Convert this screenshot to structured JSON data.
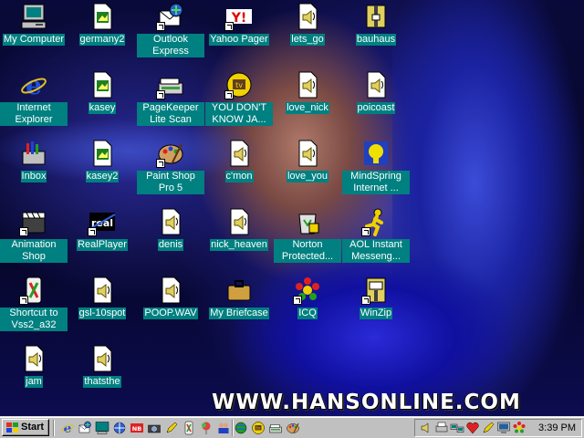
{
  "desktop": {
    "watermark": "WWW.HANSONLINE.COM",
    "icons": [
      {
        "id": "my-computer",
        "label": "My Computer",
        "icon": "computer-icon",
        "shortcut": false
      },
      {
        "id": "germany2",
        "label": "germany2",
        "icon": "image-file-icon",
        "shortcut": false
      },
      {
        "id": "outlook-express",
        "label": "Outlook Express",
        "icon": "outlook-express-icon",
        "shortcut": true
      },
      {
        "id": "yahoo-pager",
        "label": "Yahoo Pager",
        "icon": "yahoo-pager-icon",
        "shortcut": true
      },
      {
        "id": "lets-go",
        "label": "lets_go",
        "icon": "sound-file-icon",
        "shortcut": false
      },
      {
        "id": "bauhaus",
        "label": "bauhaus",
        "icon": "zip-archive-icon",
        "shortcut": false
      },
      {
        "id": "internet-explorer",
        "label": "Internet Explorer",
        "icon": "internet-explorer-icon",
        "shortcut": false
      },
      {
        "id": "kasey",
        "label": "kasey",
        "icon": "image-file-icon",
        "shortcut": false
      },
      {
        "id": "pagekeeper",
        "label": "PageKeeper Lite Scan",
        "icon": "scanner-icon",
        "shortcut": true
      },
      {
        "id": "you-dont-know-jack",
        "label": "YOU DON'T KNOW JA...",
        "icon": "tv-game-icon",
        "shortcut": true
      },
      {
        "id": "love-nick",
        "label": "love_nick",
        "icon": "sound-file-icon",
        "shortcut": false
      },
      {
        "id": "poicoast",
        "label": "poicoast",
        "icon": "sound-file-icon",
        "shortcut": false
      },
      {
        "id": "inbox",
        "label": "Inbox",
        "icon": "inbox-icon",
        "shortcut": false
      },
      {
        "id": "kasey2",
        "label": "kasey2",
        "icon": "image-file-icon",
        "shortcut": false
      },
      {
        "id": "paint-shop-pro",
        "label": "Paint Shop Pro 5",
        "icon": "paint-palette-icon",
        "shortcut": true
      },
      {
        "id": "cmon",
        "label": "c'mon",
        "icon": "sound-file-icon",
        "shortcut": false
      },
      {
        "id": "love-you",
        "label": "love_you",
        "icon": "sound-file-icon",
        "shortcut": false
      },
      {
        "id": "mindspring",
        "label": "MindSpring Internet ...",
        "icon": "mindspring-icon",
        "shortcut": false
      },
      {
        "id": "animation-shop",
        "label": "Animation Shop",
        "icon": "film-clapper-icon",
        "shortcut": true
      },
      {
        "id": "realplayer",
        "label": "RealPlayer",
        "icon": "realplayer-icon",
        "shortcut": true
      },
      {
        "id": "denis",
        "label": "denis",
        "icon": "sound-file-icon",
        "shortcut": false
      },
      {
        "id": "nick-heaven",
        "label": "nick_heaven",
        "icon": "sound-file-icon",
        "shortcut": false
      },
      {
        "id": "norton-protected",
        "label": "Norton Protected...",
        "icon": "recycle-bin-icon",
        "shortcut": false
      },
      {
        "id": "aol-instant-messenger",
        "label": "AOL Instant Messeng...",
        "icon": "aim-running-man-icon",
        "shortcut": true
      },
      {
        "id": "shortcut-vss2",
        "label": "Shortcut to Vss2_a32",
        "icon": "tools-icon",
        "shortcut": true
      },
      {
        "id": "gsl-10spot",
        "label": "gsl-10spot",
        "icon": "sound-file-icon",
        "shortcut": false
      },
      {
        "id": "poop-wav",
        "label": "POOP.WAV",
        "icon": "sound-file-icon",
        "shortcut": false
      },
      {
        "id": "my-briefcase",
        "label": "My Briefcase",
        "icon": "briefcase-icon",
        "shortcut": false
      },
      {
        "id": "icq",
        "label": "ICQ",
        "icon": "icq-flower-icon",
        "shortcut": true
      },
      {
        "id": "winzip",
        "label": "WinZip",
        "icon": "winzip-icon",
        "shortcut": true
      },
      {
        "id": "jam",
        "label": "jam",
        "icon": "sound-file-icon",
        "shortcut": false
      },
      {
        "id": "thatsthe",
        "label": "thatsthe",
        "icon": "sound-file-icon",
        "shortcut": false
      }
    ]
  },
  "taskbar": {
    "start_label": "Start",
    "quick_launch": [
      "internet-explorer-icon",
      "outlook-express-icon",
      "show-desktop-icon",
      "channels-icon",
      "nb-icon",
      "camera-icon",
      "pen-icon",
      "tools-icon",
      "balloon-icon",
      "people-icon",
      "globe-icon",
      "tv-game-icon",
      "scanner-icon",
      "paint-palette-icon"
    ],
    "tray_icons": [
      "volume-icon",
      "printer-icon",
      "network-icon",
      "heart-icon",
      "pen-icon",
      "monitor-icon",
      "icq-flower-icon"
    ],
    "clock": "3:39 PM"
  }
}
